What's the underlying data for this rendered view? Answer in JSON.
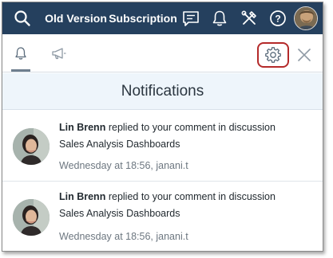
{
  "topbar": {
    "old_version_label": "Old Version",
    "subscription_label": "Subscription"
  },
  "panel": {
    "title": "Notifications"
  },
  "notifications": [
    {
      "user": "Lin Brenn",
      "action": "replied to your comment in discussion",
      "target": "Sales Analysis Dashboards",
      "meta": "Wednesday at 18:56, janani.t"
    },
    {
      "user": "Lin Brenn",
      "action": "replied to your comment in discussion",
      "target": "Sales Analysis Dashboards",
      "meta": "Wednesday at 18:56, janani.t"
    }
  ],
  "colors": {
    "topbar_bg": "#25405e",
    "highlight_border": "#b42a2a",
    "header_bg": "#eef5fb"
  }
}
